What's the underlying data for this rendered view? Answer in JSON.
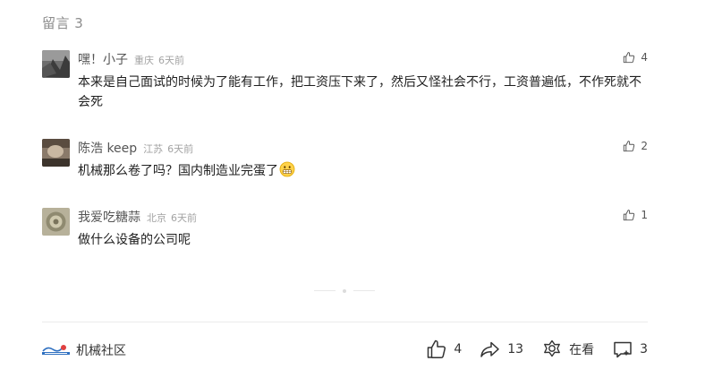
{
  "comments_header": "留言 3",
  "comments": [
    {
      "nickname": "嘿！小子",
      "location": "重庆",
      "time": "6天前",
      "likes": "4",
      "text": "本来是自己面试的时候为了能有工作，把工资压下来了，然后又怪社会不行，工资普遍低，不作死就不会死"
    },
    {
      "nickname": "陈浩 keep",
      "location": "江苏",
      "time": "6天前",
      "likes": "2",
      "text": "机械那么卷了吗？国内制造业完蛋了"
    },
    {
      "nickname": "我爱吃糖蒜",
      "location": "北京",
      "time": "6天前",
      "likes": "1",
      "text": "做什么设备的公司呢"
    }
  ],
  "footer": {
    "account_name": "机械社区",
    "like_count": "4",
    "share_count": "13",
    "wow_label": "在看",
    "comment_count": "3"
  },
  "colors": {
    "muted": "#8c8c8c",
    "text": "#1f1f1f",
    "divider": "#ebebeb"
  }
}
